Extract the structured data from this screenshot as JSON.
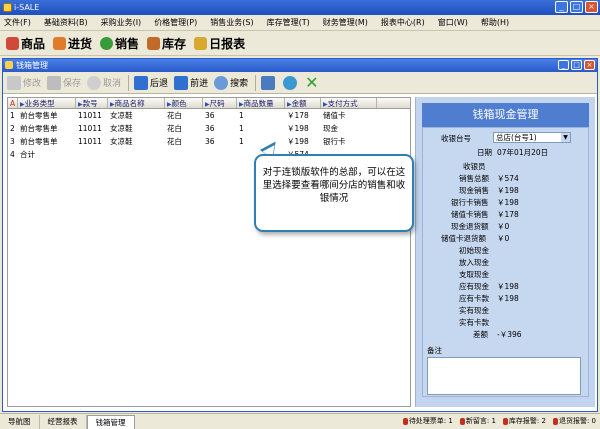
{
  "app": {
    "title": "i-SALE"
  },
  "menu": [
    "文件(F)",
    "基础资料(B)",
    "采购业务(I)",
    "价格管理(P)",
    "销售业务(S)",
    "库存管理(T)",
    "财务管理(M)",
    "报表中心(R)",
    "窗口(W)",
    "帮助(H)"
  ],
  "modules": [
    {
      "label": "商品",
      "color": "#d04a3a",
      "icon": "goods-icon"
    },
    {
      "label": "进货",
      "color": "#e07b2a",
      "icon": "purchase-icon"
    },
    {
      "label": "销售",
      "color": "#3a9a3a",
      "icon": "sales-icon"
    },
    {
      "label": "库存",
      "color": "#c26a2a",
      "icon": "stock-icon"
    },
    {
      "label": "日报表",
      "color": "#d8a830",
      "icon": "daily-report-icon"
    }
  ],
  "inner_window": {
    "title": "钱箱管理"
  },
  "toolbar": {
    "edit": "修改",
    "save": "保存",
    "cancel": "取消",
    "back": "后退",
    "forward": "前进",
    "search": "搜索"
  },
  "grid": {
    "corner": "A",
    "columns": [
      "业务类型",
      "款号",
      "商品名称",
      "颜色",
      "尺码",
      "商品数量",
      "金额",
      "支付方式"
    ],
    "rows": [
      {
        "n": "1",
        "type": "前台零售单",
        "code": "11011",
        "name": "女凉鞋",
        "color": "花白",
        "size": "36",
        "qty": "1",
        "amount": "￥178",
        "pay": "储值卡"
      },
      {
        "n": "2",
        "type": "前台零售单",
        "code": "11011",
        "name": "女凉鞋",
        "color": "花白",
        "size": "36",
        "qty": "1",
        "amount": "￥198",
        "pay": "现金"
      },
      {
        "n": "3",
        "type": "前台零售单",
        "code": "11011",
        "name": "女凉鞋",
        "color": "花白",
        "size": "36",
        "qty": "1",
        "amount": "￥198",
        "pay": "银行卡"
      },
      {
        "n": "4",
        "type": "合计",
        "code": "",
        "name": "",
        "color": "",
        "size": "",
        "qty": "",
        "amount": "￥574",
        "pay": ""
      }
    ]
  },
  "panel": {
    "title": "钱箱现金管理",
    "register_label": "收银台号",
    "register_value": "总店(台号1)",
    "date_label": "日期",
    "date_value": "07年01月20日",
    "cashier_label": "收银员",
    "items": [
      {
        "label": "销售总额",
        "value": "￥574"
      },
      {
        "label": "现金销售",
        "value": "￥198"
      },
      {
        "label": "银行卡销售",
        "value": "￥198"
      },
      {
        "label": "储值卡销售",
        "value": "￥178"
      },
      {
        "label": "现金退货额",
        "value": "￥0"
      },
      {
        "label": "储值卡退货额",
        "value": "￥0"
      },
      {
        "label": "初始现金",
        "value": ""
      },
      {
        "label": "放入现金",
        "value": ""
      },
      {
        "label": "支取现金",
        "value": ""
      },
      {
        "label": "应有现金",
        "value": "￥198"
      },
      {
        "label": "应有卡款",
        "value": "￥198"
      },
      {
        "label": "实有现金",
        "value": ""
      },
      {
        "label": "实有卡款",
        "value": ""
      },
      {
        "label": "差额",
        "value": "-￥396"
      }
    ],
    "memo_label": "备注"
  },
  "callout": {
    "text": "对于连锁版软件的总部，可以在这里选择要查看哪间分店的销售和收银情况"
  },
  "status": {
    "tabs": [
      "导航图",
      "经营报表",
      "钱箱管理"
    ],
    "right": [
      "待处理票单: 1",
      "新留言: 1",
      "库存报警: 2",
      "退货报警: 0"
    ]
  }
}
